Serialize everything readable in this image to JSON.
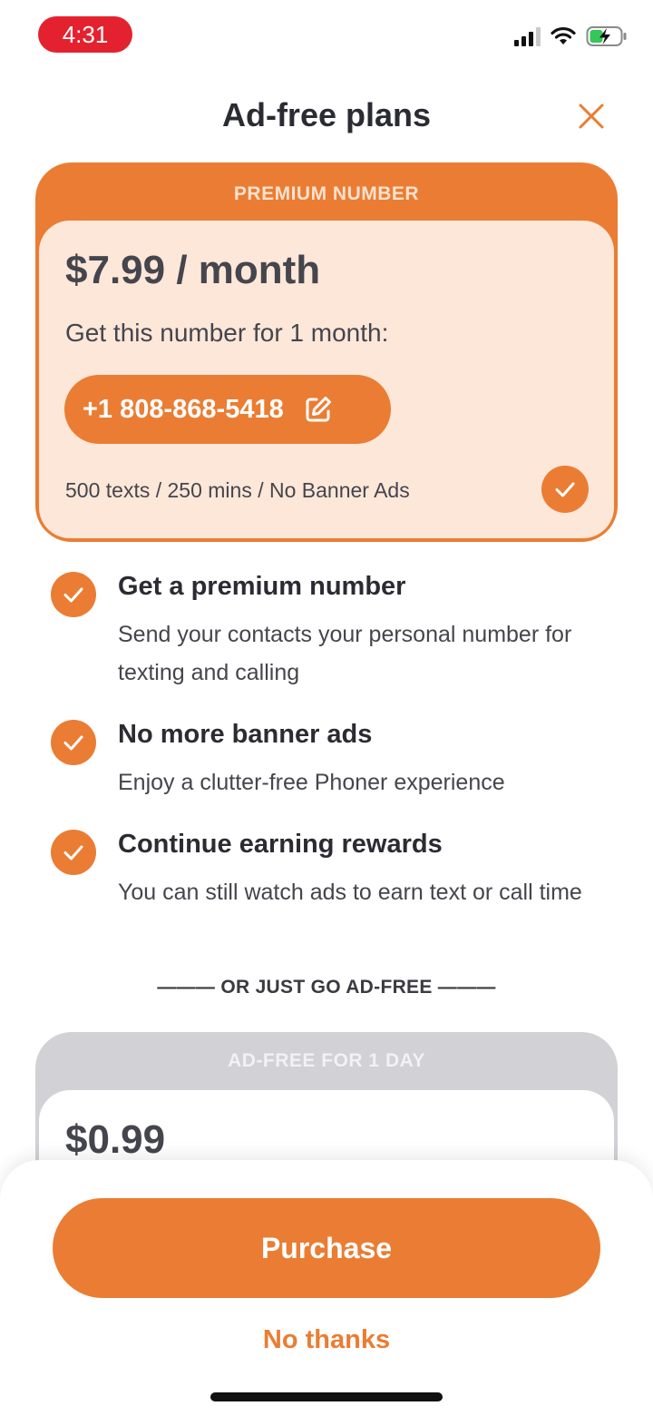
{
  "status_bar": {
    "time": "4:31",
    "icons": [
      "signal-icon",
      "wifi-icon",
      "battery-charging-icon"
    ],
    "time_pill_color": "#e4222f"
  },
  "header": {
    "title": "Ad-free plans",
    "close_icon": "close-icon"
  },
  "premium_plan": {
    "tag": "PREMIUM NUMBER",
    "price": "$7.99 / month",
    "subtitle": "Get this number for 1 month:",
    "phone_number": "+1 808-868-5418",
    "edit_icon": "edit-icon",
    "quota": "500 texts / 250 mins / No Banner Ads",
    "selected": true
  },
  "features": [
    {
      "title": "Get a premium number",
      "description": "Send your contacts your personal number for texting and calling"
    },
    {
      "title": "No more banner ads",
      "description": "Enjoy a clutter-free Phoner experience"
    },
    {
      "title": "Continue earning rewards",
      "description": "You can still watch ads to earn text or call time"
    }
  ],
  "divider_text": "——— OR JUST GO AD-FREE ———",
  "adfree_plan": {
    "tag": "AD-FREE FOR 1 DAY",
    "price": "$0.99"
  },
  "actions": {
    "purchase_label": "Purchase",
    "no_thanks_label": "No thanks"
  },
  "colors": {
    "accent": "#ea7d33",
    "accent_light": "#fde7d9",
    "text_dark": "#2b2b33",
    "muted_card": "#d1d1d6"
  }
}
